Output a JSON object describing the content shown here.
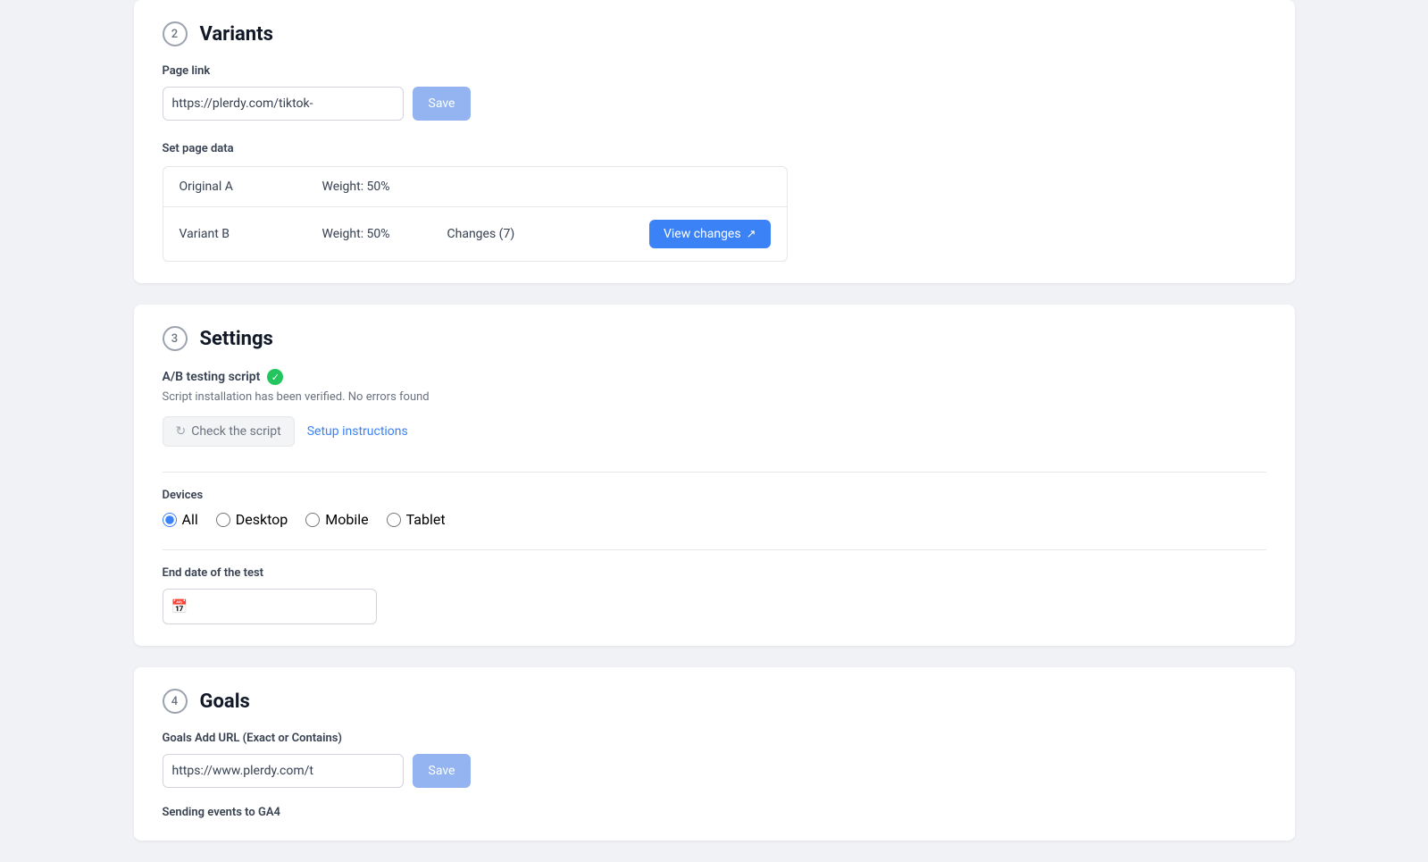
{
  "sections": {
    "variants": {
      "number": "2",
      "title": "Variants",
      "page_link_label": "Page link",
      "page_link_value": "https://plerdy.com/tiktok-",
      "save_button_label": "Save",
      "set_page_data_label": "Set page data",
      "table_rows": [
        {
          "name": "Original A",
          "weight": "Weight: 50%",
          "changes": "",
          "has_button": false
        },
        {
          "name": "Variant B",
          "weight": "Weight: 50%",
          "changes": "Changes (7)",
          "has_button": true,
          "button_label": "View changes"
        }
      ]
    },
    "settings": {
      "number": "3",
      "title": "Settings",
      "script_label": "A/B testing script",
      "script_status": "Script installation has been verified. No errors found",
      "check_script_label": "Check the script",
      "setup_instructions_label": "Setup instructions",
      "devices_label": "Devices",
      "device_options": [
        {
          "id": "all",
          "label": "All",
          "checked": true
        },
        {
          "id": "desktop",
          "label": "Desktop",
          "checked": false
        },
        {
          "id": "mobile",
          "label": "Mobile",
          "checked": false
        },
        {
          "id": "tablet",
          "label": "Tablet",
          "checked": false
        }
      ],
      "end_date_label": "End date of the test",
      "end_date_placeholder": ""
    },
    "goals": {
      "number": "4",
      "title": "Goals",
      "url_label": "Goals Add URL (Exact or Contains)",
      "url_value": "https://www.plerdy.com/t",
      "save_button_label": "Save",
      "sending_events_label": "Sending events to GA4"
    }
  },
  "icons": {
    "refresh": "↻",
    "external": "↗",
    "calendar": "📅",
    "check": "✓"
  }
}
